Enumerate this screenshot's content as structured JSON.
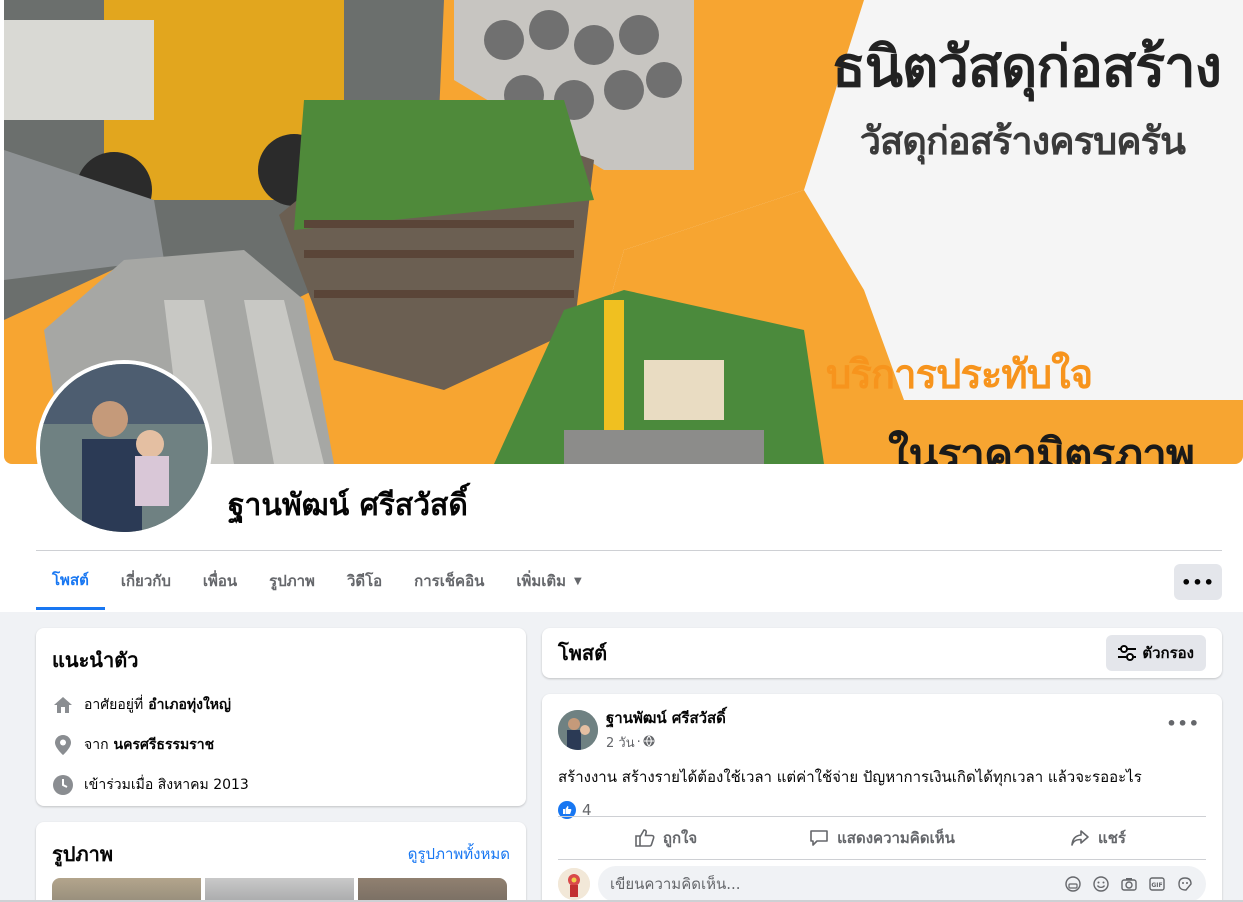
{
  "cover": {
    "title": "ธนิตวัสดุก่อสร้าง",
    "subtitle": "วัสดุก่อสร้างครบครัน",
    "service": "บริการประทับใจ",
    "price": "ในราคามิตรภาพ",
    "accent_color": "#f7a531"
  },
  "profile": {
    "name": "ฐานพัฒน์ ศรีสวัสดิ์"
  },
  "tabs": [
    {
      "label": "โพสต์",
      "active": true
    },
    {
      "label": "เกี่ยวกับ",
      "active": false
    },
    {
      "label": "เพื่อน",
      "active": false
    },
    {
      "label": "รูปภาพ",
      "active": false
    },
    {
      "label": "วิดีโอ",
      "active": false
    },
    {
      "label": "การเช็คอิน",
      "active": false
    },
    {
      "label": "เพิ่มเติม",
      "active": false
    }
  ],
  "more_button": "•••",
  "intro": {
    "title": "แนะนำตัว",
    "lives_prefix": "อาศัยอยู่ที่",
    "lives_place": "อำเภอทุ่งใหญ่",
    "from_prefix": "จาก",
    "from_place": "นครศรีธรรมราช",
    "joined": "เข้าร่วมเมื่อ สิงหาคม 2013"
  },
  "photos": {
    "title": "รูปภาพ",
    "see_all": "ดูรูปภาพทั้งหมด"
  },
  "posts": {
    "title": "โพสต์",
    "filter_label": "ตัวกรอง"
  },
  "post": {
    "author": "ฐานพัฒน์ ศรีสวัสดิ์",
    "time": "2 วัน",
    "privacy_icon": "globe-icon",
    "text": "สร้างงาน สร้างรายได้ต้องใช้เวลา  แต่ค่าใช้จ่าย ปัญหาการเงินเกิดได้ทุกเวลา แล้วจะรออะไร",
    "likes": "4",
    "like_label": "ถูกใจ",
    "comment_label": "แสดงความคิดเห็น",
    "share_label": "แชร์",
    "comment_placeholder": "เขียนความคิดเห็น..."
  },
  "colors": {
    "brand": "#1877f2",
    "background": "#f0f2f5"
  }
}
